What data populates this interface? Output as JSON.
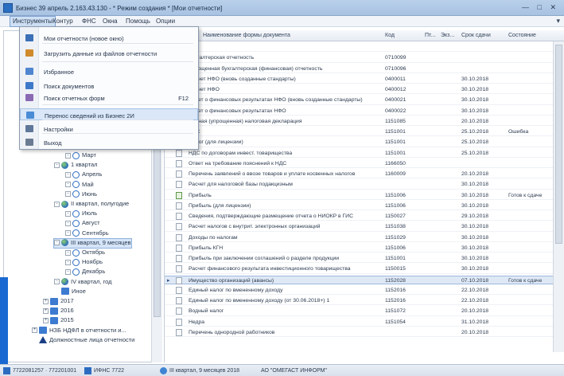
{
  "window": {
    "title": "Бизнес 39 апрель 2.163.43.130 - * Режим создания * [Мои отчетности]",
    "controls": "—  □  ✕"
  },
  "menubar": {
    "items": [
      {
        "label": "Инструменты"
      },
      {
        "label": "Контур"
      },
      {
        "label": "ФНС"
      },
      {
        "label": "Окна"
      },
      {
        "label": "Помощь"
      },
      {
        "label": "Опции"
      }
    ],
    "right_arrow": "▾"
  },
  "dropdown": {
    "items": [
      {
        "label": "Мои отчетности (новое окно)",
        "key": "",
        "icon_color": "#3b6fb7"
      },
      {
        "label": "Загрузить данные из файлов отчетности",
        "key": "",
        "icon_color": "#d08a2c"
      },
      {
        "label": "Избранное",
        "key": "",
        "icon_color": "#4f86cf"
      },
      {
        "label": "Поиск документов",
        "key": "",
        "icon_color": "#3d79c9"
      },
      {
        "label": "Поиск отчетных форм",
        "key": "F12",
        "icon_color": "#8a6ab3"
      },
      {
        "label": "Перенос сведений из Бизнес 2И",
        "key": "",
        "icon_color": "#4a8bd6"
      },
      {
        "label": "Настройки",
        "key": "",
        "icon_color": "#5f7899"
      },
      {
        "label": "Выход",
        "key": "",
        "icon_color": "#6b7c92"
      }
    ]
  },
  "tree": {
    "rows": [
      {
        "label": "Март",
        "icon": "clock",
        "indent": 92,
        "expander": "-"
      },
      {
        "label": "1 квартал",
        "icon": "globe",
        "indent": 78,
        "expander": "-"
      },
      {
        "label": "Апрель",
        "icon": "clock",
        "indent": 92,
        "expander": "-"
      },
      {
        "label": "Май",
        "icon": "clock",
        "indent": 92,
        "expander": "-"
      },
      {
        "label": "Июнь",
        "icon": "clock",
        "indent": 92,
        "expander": "-"
      },
      {
        "label": "II квартал, полугодие",
        "icon": "globe",
        "indent": 78,
        "expander": "-"
      },
      {
        "label": "Июль",
        "icon": "clock",
        "indent": 92,
        "expander": "-"
      },
      {
        "label": "Август",
        "icon": "clock",
        "indent": 92,
        "expander": "-"
      },
      {
        "label": "Сентябрь",
        "icon": "clock",
        "indent": 92,
        "expander": "-"
      },
      {
        "label": "III квартал, 9 месяцев",
        "icon": "globe",
        "indent": 78,
        "expander": "-",
        "selected": true
      },
      {
        "label": "Октябрь",
        "icon": "clock",
        "indent": 92,
        "expander": "-"
      },
      {
        "label": "Ноябрь",
        "icon": "clock",
        "indent": 92,
        "expander": "-"
      },
      {
        "label": "Декабрь",
        "icon": "clock",
        "indent": 92,
        "expander": "-"
      },
      {
        "label": "IV квартал, год",
        "icon": "globe",
        "indent": 78,
        "expander": "-"
      },
      {
        "label": "Иное",
        "icon": "cal",
        "indent": 78,
        "expander": ""
      },
      {
        "label": "2017",
        "icon": "cal",
        "indent": 64,
        "expander": "+"
      },
      {
        "label": "2016",
        "icon": "cal",
        "indent": 64,
        "expander": "+"
      },
      {
        "label": "2015",
        "icon": "cal",
        "indent": 64,
        "expander": "+"
      },
      {
        "label": "НЗБ НДФЛ в отчетности и...",
        "icon": "cal",
        "indent": 50,
        "expander": "+"
      },
      {
        "label": "Должностные лица отчетности",
        "icon": "warn",
        "indent": 50,
        "expander": ""
      }
    ]
  },
  "grid": {
    "headers": [
      {
        "label": "Наименование формы документа"
      },
      {
        "label": "Код"
      },
      {
        "label": "Пт..."
      },
      {
        "label": "Экз..."
      },
      {
        "label": "Срок сдачи"
      },
      {
        "label": "Состояние"
      }
    ],
    "rows": [
      {
        "name": "",
        "code": "",
        "date": "",
        "status": ""
      },
      {
        "name": "Бухгалтерская отчетность",
        "code": "0710099",
        "date": "",
        "status": ""
      },
      {
        "name": "Упрощенная бухгалтерская (финансовая) отчетность",
        "code": "0710096",
        "date": "",
        "status": ""
      },
      {
        "name": "Расчет НФО (вновь созданные стандарты)",
        "code": "0400011",
        "date": "30.10.2018",
        "status": ""
      },
      {
        "name": "Расчет НФО",
        "code": "0400012",
        "date": "30.10.2018",
        "status": ""
      },
      {
        "name": "Отчет о финансовых результатах НФО (вновь созданные стандарты)",
        "code": "0400021",
        "date": "30.10.2018",
        "status": ""
      },
      {
        "name": "Отчет о финансовых результатах НФО",
        "code": "0400022",
        "date": "30.10.2018",
        "status": ""
      },
      {
        "name": "Единая (упрощенная) налоговая декларация",
        "code": "1151085",
        "date": "20.10.2018",
        "status": ""
      },
      {
        "name": "НДС",
        "code": "1151001",
        "date": "25.10.2018",
        "status": "Ошибка"
      },
      {
        "name": "Налог (для лицензии)",
        "code": "1151001",
        "date": "25.10.2018",
        "status": ""
      },
      {
        "name": "НДС по договорам инвест. товарищества",
        "code": "1151001",
        "date": "25.10.2018",
        "status": ""
      },
      {
        "name": "Ответ на требование пояснений к НДС",
        "code": "1166050",
        "date": "",
        "status": ""
      },
      {
        "name": "Перечень заявлений о ввозе товаров и уплате косвенных налогов",
        "code": "1160009",
        "date": "20.10.2018",
        "status": ""
      },
      {
        "name": "Расчет для налоговой базы подакцизным",
        "code": "",
        "date": "30.10.2018",
        "status": ""
      },
      {
        "name": "Прибыль",
        "code": "1151006",
        "date": "30.10.2018",
        "status": "Готов к сдаче",
        "active": true
      },
      {
        "name": "Прибыль (для лицензии)",
        "code": "1151006",
        "date": "30.10.2018",
        "status": ""
      },
      {
        "name": "Сведения, подтверждающие размещение отчета о НИОКР в ГИС",
        "code": "1150027",
        "date": "29.10.2018",
        "status": ""
      },
      {
        "name": "Расчет налогов с внутрит. электронных организаций",
        "code": "1151038",
        "date": "30.10.2018",
        "status": ""
      },
      {
        "name": "Доходы по налогам",
        "code": "1151029",
        "date": "30.10.2018",
        "status": ""
      },
      {
        "name": "Прибыль КГН",
        "code": "1151006",
        "date": "30.10.2018",
        "status": ""
      },
      {
        "name": "Прибыль при заключении соглашений о разделе продукции",
        "code": "1151001",
        "date": "30.10.2018",
        "status": ""
      },
      {
        "name": "Расчет финансового результата инвестиционного товарищества",
        "code": "1150015",
        "date": "30.10.2018",
        "status": ""
      },
      {
        "name": "Имущество организаций (авансы)",
        "code": "1152028",
        "date": "07.10.2018",
        "status": "Готов к сдаче",
        "selected": true
      },
      {
        "name": "Единый налог по вмененному доходу",
        "code": "1152016",
        "date": "22.10.2018",
        "status": ""
      },
      {
        "name": "Единый налог по вмененному доходу (от 30.06.2018+) 1",
        "code": "1152016",
        "date": "22.10.2018",
        "status": ""
      },
      {
        "name": "Водный налог",
        "code": "1151072",
        "date": "20.10.2018",
        "status": ""
      },
      {
        "name": "Недра",
        "code": "1151054",
        "date": "31.10.2018",
        "status": ""
      },
      {
        "name": "Перечень однородной работников",
        "code": "",
        "date": "20.10.2018",
        "status": ""
      }
    ]
  },
  "statusbar": {
    "items": [
      {
        "label": "7722081257 · 772201001",
        "icon_color": "#2b6cc0"
      },
      {
        "label": "ИФНС 7722",
        "icon_color": "#2b6cc0"
      },
      {
        "label": "III квартал, 9 месяцев 2018",
        "icon_color": "#3f84d2"
      },
      {
        "label": "АО \"ОМЕГАСТ ИНФОРМ\"",
        "icon_color": ""
      }
    ]
  },
  "colors": {
    "accent": "#2b6cc0",
    "selection": "#dfe9f6",
    "titlebar": "#b9d0ea"
  }
}
